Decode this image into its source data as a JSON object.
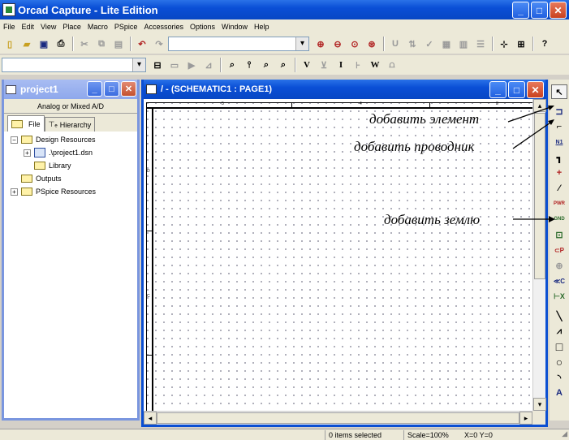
{
  "app": {
    "title": "Orcad Capture - Lite Edition",
    "controls": {
      "minimize": "_",
      "maximize": "□",
      "close": "✕"
    }
  },
  "menu": [
    "File",
    "Edit",
    "View",
    "Place",
    "Macro",
    "PSpice",
    "Accessories",
    "Options",
    "Window",
    "Help"
  ],
  "toolbar2_text_buttons": [
    "V",
    "I",
    "W"
  ],
  "project_window": {
    "title": "project1",
    "subtitle": "Analog or Mixed A/D",
    "tabs": [
      "File",
      "Hierarchy"
    ],
    "tree": {
      "design_resources": "Design Resources",
      "dsn_file": ".\\project1.dsn",
      "library": "Library",
      "outputs": "Outputs",
      "pspice_resources": "PSpice Resources"
    }
  },
  "schematic_window": {
    "title": "/ - (SCHEMATIC1 : PAGE1)",
    "zones_top": [
      "5",
      "4",
      "3"
    ],
    "zones_left": [
      "D",
      "C"
    ]
  },
  "annotations": {
    "add_part": "добавить элемент",
    "add_wire": "добавить проводник",
    "add_ground": "добавить землю"
  },
  "palette": {
    "select": "↖",
    "part": "⊐",
    "wire": "⌐",
    "net_alias": "N1",
    "bus": "┓",
    "junction": "+",
    "bus_entry": "⁄",
    "power": "PWR",
    "ground": "GND",
    "hier_block": "⊡",
    "hier_port": "⊂P",
    "hier_pin": "⊕",
    "off_page": "≪C",
    "no_connect": "⊢X",
    "line": "╲",
    "polyline": "⩘",
    "rectangle": "□",
    "ellipse": "○",
    "arc": "◝",
    "text": "A"
  },
  "status": {
    "selection": "0 items selected",
    "scale": "Scale=100%",
    "coords": "X=0  Y=0"
  }
}
